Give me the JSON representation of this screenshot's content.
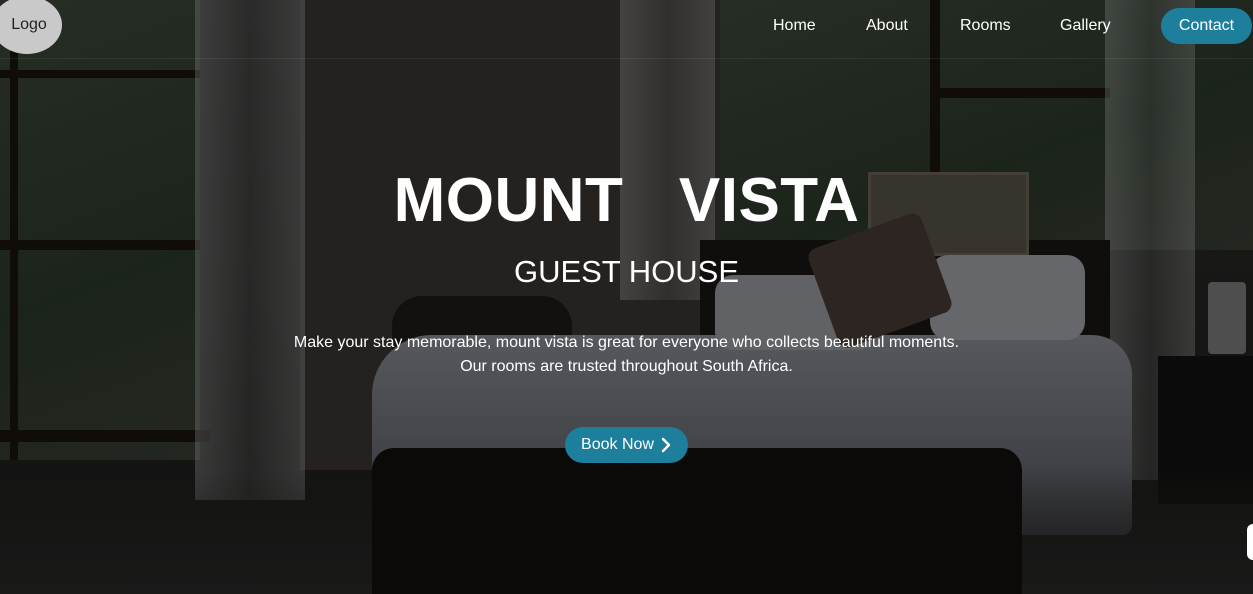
{
  "header": {
    "logo_text": "Logo",
    "nav": {
      "home": "Home",
      "about": "About",
      "rooms": "Rooms",
      "gallery": "Gallery",
      "contact": "Contact"
    }
  },
  "hero": {
    "title": "MOUNT  VISTA",
    "subtitle": "GUEST HOUSE",
    "description_line1": "Make your stay memorable, mount vista is great for everyone who collects beautiful moments.",
    "description_line2": "Our rooms are trusted throughout South Africa.",
    "cta_label": "Book Now",
    "cta_icon": "chevron-right-icon"
  },
  "colors": {
    "accent": "#1d7f9c",
    "text": "#ffffff"
  }
}
